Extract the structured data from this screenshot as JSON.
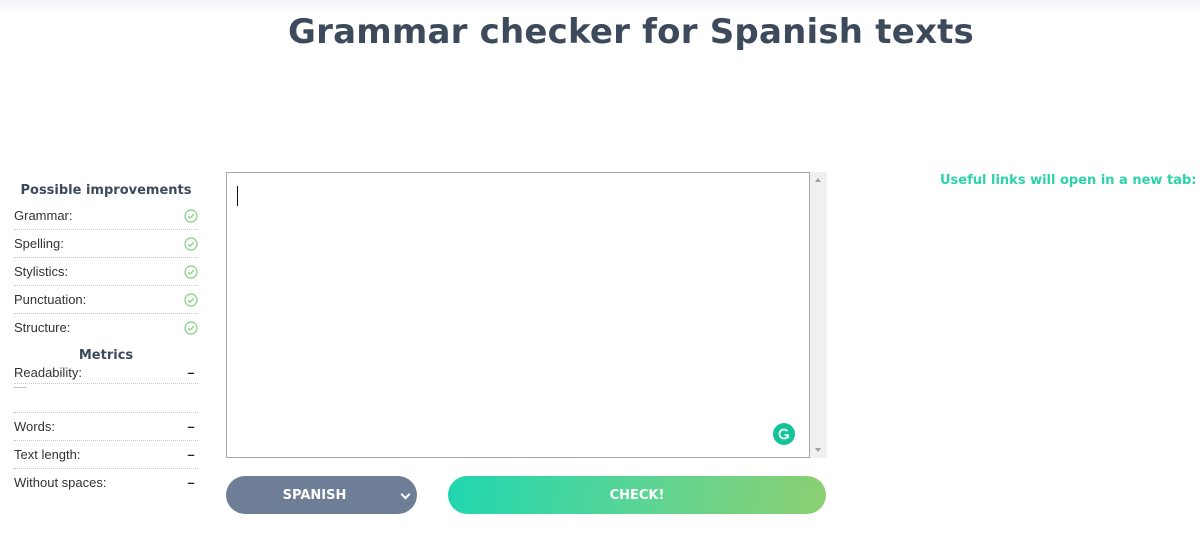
{
  "page": {
    "title": "Grammar checker for Spanish texts"
  },
  "improvements": {
    "heading": "Possible improvements",
    "items": [
      {
        "label": "Grammar:",
        "status_icon": "check-circle-icon"
      },
      {
        "label": "Spelling:",
        "status_icon": "check-circle-icon"
      },
      {
        "label": "Stylistics:",
        "status_icon": "check-circle-icon"
      },
      {
        "label": "Punctuation:",
        "status_icon": "check-circle-icon"
      },
      {
        "label": "Structure:",
        "status_icon": "check-circle-icon"
      }
    ],
    "ok_color": "#7ed07e"
  },
  "metrics": {
    "heading": "Metrics",
    "readability": {
      "label": "Readability:",
      "value": "–"
    },
    "items": [
      {
        "label": "Words:",
        "value": "–"
      },
      {
        "label": "Text length:",
        "value": "–"
      },
      {
        "label": "Without spaces:",
        "value": "–"
      }
    ]
  },
  "editor": {
    "value": "",
    "placeholder": ""
  },
  "controls": {
    "language_selected": "SPANISH",
    "check_label": "CHECK!",
    "accent_start": "#1fd6b0",
    "accent_end": "#8ccf70",
    "select_color": "#6e7e96"
  },
  "links": {
    "note": "Useful links will open in a new tab:"
  }
}
